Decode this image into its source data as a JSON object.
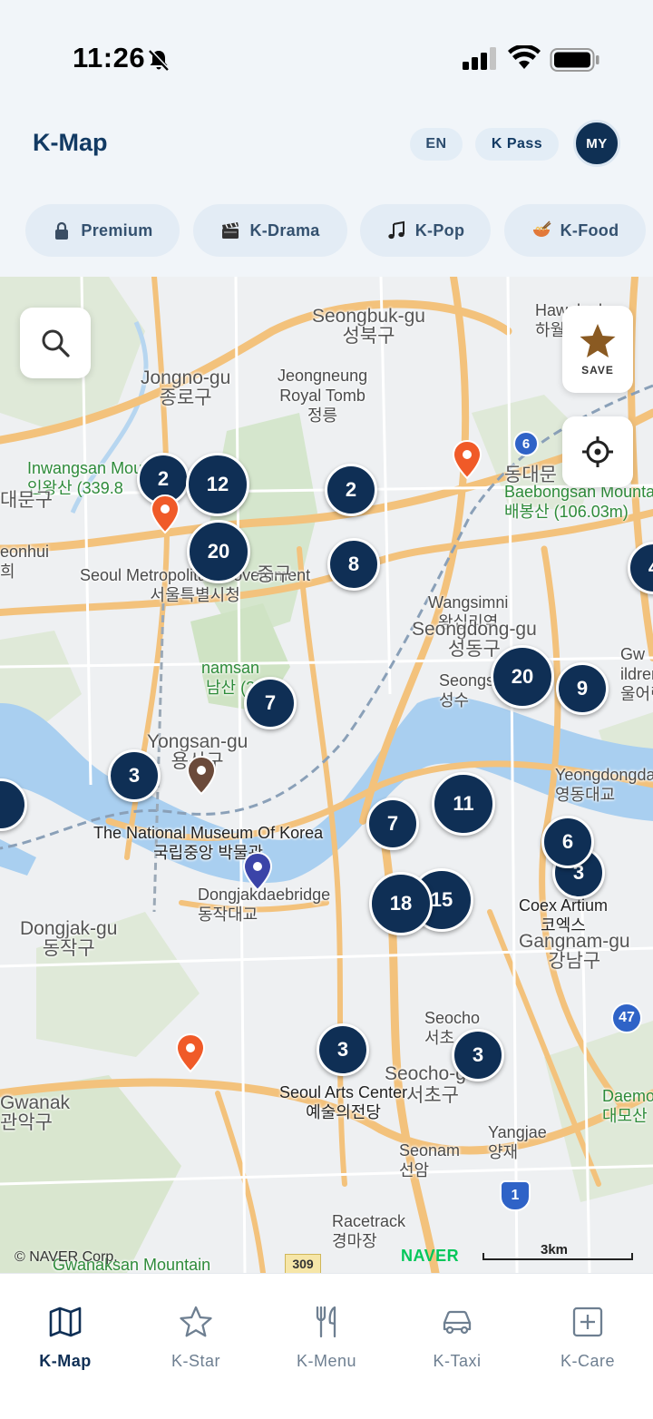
{
  "status_bar": {
    "time": "11:26"
  },
  "header": {
    "title": "K-Map",
    "language": "EN",
    "kpass_label": "K Pass",
    "my_label": "MY"
  },
  "categories": [
    {
      "label": "Premium",
      "icon": "lock-icon"
    },
    {
      "label": "K-Drama",
      "icon": "clapperboard-icon"
    },
    {
      "label": "K-Pop",
      "icon": "music-note-icon"
    },
    {
      "label": "K-Food",
      "icon": "noodle-bowl-icon"
    }
  ],
  "map": {
    "save_label": "SAVE",
    "copyright": "© NAVER Corp.",
    "naver_logo": "NAVER",
    "scale_label": "3km",
    "districts": {
      "seongbuk_en": "Seongbuk-gu",
      "seongbuk_ko": "성북구",
      "jongno_en": "Jongno-gu",
      "jongno_ko": "종로구",
      "jeongneung_en": "Jeongneung",
      "jeongneung_en2": "Royal Tomb",
      "jeongneung_ko": "정릉",
      "inwangsan": "인왕산 (339.8",
      "inwangsan_en": "Inwangsan Mou",
      "seodaemun": "대문구",
      "hawolgok": "Hawolgok",
      "hawolgok_ko": "하월",
      "dongdaemun": "동대문",
      "baebongsan_en": "Baebongsan Mountai",
      "baebongsan_ko": "배봉산 (106.03m)",
      "seoul_city_en": "Seoul Metropolitan Government",
      "seoul_city_ko": "서울특별시청",
      "junggu": "중구",
      "wangsimni_en": "Wangsimni",
      "wangsimni_ko": "왕십리역",
      "seongdong_en": "Seongdong-gu",
      "seongdong_ko": "성동구",
      "namsan_en": "namsan",
      "namsan_ko": "남산 (2",
      "seongsu_en": "Seongs",
      "seongsu_ko": "성수",
      "yongsan_en": "Yongsan-gu",
      "yongsan_ko": "용산구",
      "museum_en": "The National Museum Of Korea",
      "museum_ko": "국립중앙 박물관",
      "dongjakbridge_en": "Dongjakdaebridge",
      "dongjakbridge_ko": "동작대교",
      "yeongdong_en": "Yeongdongdae",
      "yeongdong_ko": "영동대교",
      "dongjak_en": "Dongjak-gu",
      "dongjak_ko": "동작구",
      "coex_en": "Coex Artium",
      "coex_ko": "코엑스",
      "gangnam_en": "Gangnam-gu",
      "gangnam_ko": "강남구",
      "seocho_st_en": "Seocho",
      "seocho_st_ko": "서초",
      "seocho_en": "Seocho-gu",
      "seocho_ko": "서초구",
      "arts_en": "Seoul Arts Center",
      "arts_ko": "예술의전당",
      "gwanak_en": "Gwanak",
      "gwanak_ko": "관악구",
      "seonam_en": "Seonam",
      "seonam_ko": "선암",
      "yangjae_en": "Yangjae",
      "yangjae_ko": "양재",
      "racetrack_en": "Racetrack",
      "racetrack_ko": "경마장",
      "daemosan_en": "Daemosan",
      "daemosan_ko": "대모산",
      "gwanaksan": "Gwanaksan Mountain",
      "gwangjin": "Gw",
      "children": "ildren's",
      "children_ko": "울어린",
      "seonhui": "eonhui",
      "seonhui_ko": "희",
      "route6": "6",
      "route47": "47",
      "route1": "1",
      "route309": "309"
    },
    "clusters": [
      "2",
      "12",
      "20",
      "2",
      "8",
      "4",
      "20",
      "9",
      "7",
      "3",
      "11",
      "7",
      "6",
      "3",
      "18",
      "15",
      "3",
      "3"
    ]
  },
  "bottom_nav": [
    {
      "label": "K-Map",
      "icon": "map-icon",
      "active": true
    },
    {
      "label": "K-Star",
      "icon": "star-icon",
      "active": false
    },
    {
      "label": "K-Menu",
      "icon": "utensils-icon",
      "active": false
    },
    {
      "label": "K-Taxi",
      "icon": "car-icon",
      "active": false
    },
    {
      "label": "K-Care",
      "icon": "plus-square-icon",
      "active": false
    }
  ],
  "colors": {
    "primary": "#0f2f55",
    "pin_orange": "#f05a28",
    "pin_brown": "#6b4a3a",
    "pin_indigo": "#3b44a8",
    "river": "#a9cff0",
    "road": "#f6c47a",
    "naver_green": "#03c75a"
  }
}
